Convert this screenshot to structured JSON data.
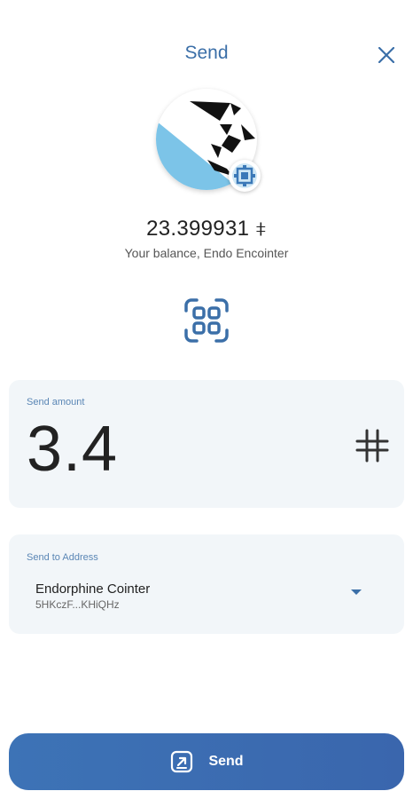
{
  "header": {
    "title": "Send"
  },
  "close_icon": "close-icon",
  "account": {
    "balance": "23.399931 ⧧",
    "balance_label": "Your balance, Endo Encointer"
  },
  "qr_icon": "qr-scan-icon",
  "amount": {
    "label": "Send amount",
    "value": "3.4",
    "currency_icon": "community-currency-icon"
  },
  "recipient": {
    "label": "Send to Address",
    "name": "Endorphine Cointer",
    "address_short": "5HKczF...KHiQHz",
    "dropdown_icon": "dropdown-arrow-icon"
  },
  "send_button": {
    "label": "Send",
    "icon": "send-arrow-icon"
  },
  "colors": {
    "accent": "#3b6fa8",
    "card_bg": "#f2f6f9",
    "button_bg": "#3d73b6"
  }
}
